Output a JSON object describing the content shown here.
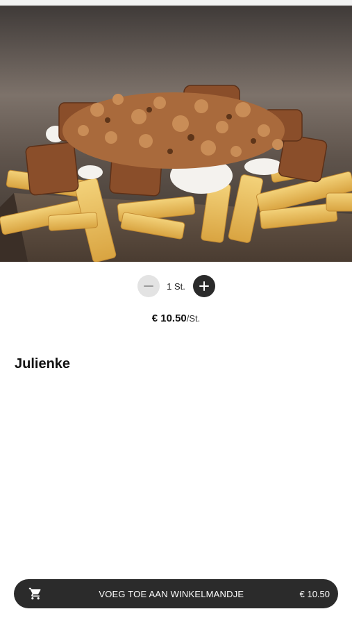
{
  "product": {
    "image_alt": "Julienke",
    "name": "Julienke"
  },
  "quantity": {
    "label": "1 St."
  },
  "price": {
    "amount": "€ 10.50",
    "unit": "/St."
  },
  "cart": {
    "label": "VOEG TOE AAN WINKELMANDJE",
    "total": "€ 10.50"
  },
  "icons": {
    "close": "close-icon",
    "minus": "minus-icon",
    "plus": "plus-icon",
    "cart": "shopping-cart-icon"
  }
}
